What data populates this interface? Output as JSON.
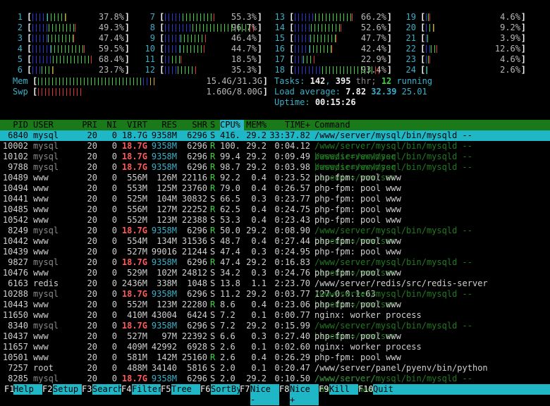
{
  "cpus": [
    {
      "id": "1",
      "pct": "37.8%",
      "low": 0.16,
      "norm": 0.2,
      "high": 0.02
    },
    {
      "id": "2",
      "pct": "49.3%",
      "low": 0.18,
      "norm": 0.28,
      "high": 0.03
    },
    {
      "id": "3",
      "pct": "47.4%",
      "low": 0.17,
      "norm": 0.28,
      "high": 0.02
    },
    {
      "id": "4",
      "pct": "59.5%",
      "low": 0.2,
      "norm": 0.36,
      "high": 0.03
    },
    {
      "id": "5",
      "pct": "68.4%",
      "low": 0.22,
      "norm": 0.42,
      "high": 0.04
    },
    {
      "id": "6",
      "pct": "23.7%",
      "low": 0.1,
      "norm": 0.12,
      "high": 0.02
    },
    {
      "id": "7",
      "pct": "55.3%",
      "low": 0.19,
      "norm": 0.34,
      "high": 0.02
    },
    {
      "id": "8",
      "pct": "96.7%",
      "low": 0.3,
      "norm": 0.62,
      "high": 0.05
    },
    {
      "id": "9",
      "pct": "46.4%",
      "low": 0.17,
      "norm": 0.27,
      "high": 0.02
    },
    {
      "id": "10",
      "pct": "44.7%",
      "low": 0.16,
      "norm": 0.26,
      "high": 0.03
    },
    {
      "id": "11",
      "pct": "18.5%",
      "low": 0.08,
      "norm": 0.09,
      "high": 0.02
    },
    {
      "id": "12",
      "pct": "35.3%",
      "low": 0.14,
      "norm": 0.19,
      "high": 0.02
    },
    {
      "id": "13",
      "pct": "66.2%",
      "low": 0.22,
      "norm": 0.4,
      "high": 0.04
    },
    {
      "id": "14",
      "pct": "52.6%",
      "low": 0.18,
      "norm": 0.32,
      "high": 0.03
    },
    {
      "id": "15",
      "pct": "47.7%",
      "low": 0.17,
      "norm": 0.28,
      "high": 0.03
    },
    {
      "id": "16",
      "pct": "42.4%",
      "low": 0.16,
      "norm": 0.24,
      "high": 0.02
    },
    {
      "id": "17",
      "pct": "22.9%",
      "low": 0.09,
      "norm": 0.12,
      "high": 0.02
    },
    {
      "id": "18",
      "pct": "93.4%",
      "low": 0.3,
      "norm": 0.58,
      "high": 0.05
    },
    {
      "id": "19",
      "pct": "4.6%",
      "low": 0.02,
      "norm": 0.02,
      "high": 0.006
    },
    {
      "id": "20",
      "pct": "9.2%",
      "low": 0.04,
      "norm": 0.04,
      "high": 0.012
    },
    {
      "id": "21",
      "pct": "3.9%",
      "low": 0.015,
      "norm": 0.02,
      "high": 0.004
    },
    {
      "id": "22",
      "pct": "12.6%",
      "low": 0.05,
      "norm": 0.06,
      "high": 0.016
    },
    {
      "id": "23",
      "pct": "4.6%",
      "low": 0.02,
      "norm": 0.02,
      "high": 0.006
    },
    {
      "id": "24",
      "pct": "2.6%",
      "low": 0.01,
      "norm": 0.012,
      "high": 0.004
    }
  ],
  "mem": {
    "label": "Mem",
    "value": "15.4G/31.3G",
    "used": 0.47,
    "buffers": 0.03,
    "cache": 0.02
  },
  "swp": {
    "label": "Swp",
    "value": "1.60G/8.00G",
    "used": 0.2
  },
  "tasks": {
    "label": "Tasks:",
    "count": "142",
    "sep1": ",",
    "thr": "395",
    "thr_label": "thr;",
    "running": "12",
    "running_label": "running"
  },
  "load": {
    "label": "Load average:",
    "l1": "7.82",
    "l5": "32.39",
    "l15": "25.01"
  },
  "uptime": {
    "label": "Uptime:",
    "value": "00:15:26"
  },
  "headers": {
    "pid": "PID",
    "user": "USER",
    "pri": "PRI",
    "ni": "NI",
    "virt": "VIRT",
    "res": "RES",
    "shr": "SHR",
    "s": "S",
    "cpu": "CPU%",
    "mem": "MEM%",
    "time": "TIME+",
    "cmd": "Command"
  },
  "processes": [
    {
      "pid": "6840",
      "user": "mysql",
      "pri": "20",
      "ni": "0",
      "virt": "18.7G",
      "res": "9358M",
      "shr": "6296",
      "s": "S",
      "cpu": "416.",
      "mem": "29.2",
      "time": "33:37.82",
      "cmd": "/www/server/mysql/bin/mysqld --basedir=/www/ser"
    },
    {
      "pid": "10002",
      "user": "mysql",
      "pri": "20",
      "ni": "0",
      "virt": "18.7G",
      "res": "9358M",
      "shr": "6296",
      "s": "R",
      "cpu": "100.",
      "mem": "29.2",
      "time": "0:04.12",
      "cmd": "/www/server/mysql/bin/mysqld --basedir=/www/ser"
    },
    {
      "pid": "10102",
      "user": "mysql",
      "pri": "20",
      "ni": "0",
      "virt": "18.7G",
      "res": "9358M",
      "shr": "6296",
      "s": "R",
      "cpu": "99.4",
      "mem": "29.2",
      "time": "0:09.49",
      "cmd": "/www/server/mysql/bin/mysqld --basedir=/www/ser"
    },
    {
      "pid": "9788",
      "user": "mysql",
      "pri": "20",
      "ni": "0",
      "virt": "18.7G",
      "res": "9358M",
      "shr": "6296",
      "s": "R",
      "cpu": "98.7",
      "mem": "29.2",
      "time": "0:03.98",
      "cmd": "/www/server/mysql/bin/mysqld --basedir=/www/ser"
    },
    {
      "pid": "10489",
      "user": "www",
      "pri": "20",
      "ni": "0",
      "virt": "556M",
      "res": "126M",
      "shr": "22116",
      "s": "R",
      "cpu": "92.2",
      "mem": "0.4",
      "time": "0:23.52",
      "cmd": "php-fpm: pool www"
    },
    {
      "pid": "10494",
      "user": "www",
      "pri": "20",
      "ni": "0",
      "virt": "553M",
      "res": "125M",
      "shr": "23760",
      "s": "R",
      "cpu": "79.0",
      "mem": "0.4",
      "time": "0:26.57",
      "cmd": "php-fpm: pool www"
    },
    {
      "pid": "10441",
      "user": "www",
      "pri": "20",
      "ni": "0",
      "virt": "525M",
      "res": "104M",
      "shr": "30832",
      "s": "S",
      "cpu": "66.5",
      "mem": "0.3",
      "time": "0:23.77",
      "cmd": "php-fpm: pool www"
    },
    {
      "pid": "10485",
      "user": "www",
      "pri": "20",
      "ni": "0",
      "virt": "556M",
      "res": "127M",
      "shr": "22252",
      "s": "R",
      "cpu": "62.5",
      "mem": "0.4",
      "time": "0:24.75",
      "cmd": "php-fpm: pool www"
    },
    {
      "pid": "10542",
      "user": "www",
      "pri": "20",
      "ni": "0",
      "virt": "552M",
      "res": "123M",
      "shr": "22388",
      "s": "S",
      "cpu": "53.3",
      "mem": "0.4",
      "time": "0:23.43",
      "cmd": "php-fpm: pool www"
    },
    {
      "pid": "8249",
      "user": "mysql",
      "pri": "20",
      "ni": "0",
      "virt": "18.7G",
      "res": "9358M",
      "shr": "6296",
      "s": "R",
      "cpu": "50.0",
      "mem": "29.2",
      "time": "0:08.90",
      "cmd": "/www/server/mysql/bin/mysqld --basedir=/www/ser"
    },
    {
      "pid": "10442",
      "user": "www",
      "pri": "20",
      "ni": "0",
      "virt": "554M",
      "res": "134M",
      "shr": "31536",
      "s": "S",
      "cpu": "48.7",
      "mem": "0.4",
      "time": "0:27.44",
      "cmd": "php-fpm: pool www"
    },
    {
      "pid": "10439",
      "user": "www",
      "pri": "20",
      "ni": "0",
      "virt": "527M",
      "res": "99016",
      "shr": "21244",
      "s": "S",
      "cpu": "47.4",
      "mem": "0.3",
      "time": "0:24.95",
      "cmd": "php-fpm: pool www"
    },
    {
      "pid": "9827",
      "user": "mysql",
      "pri": "20",
      "ni": "0",
      "virt": "18.7G",
      "res": "9358M",
      "shr": "6296",
      "s": "R",
      "cpu": "47.4",
      "mem": "29.2",
      "time": "0:16.83",
      "cmd": "/www/server/mysql/bin/mysqld --basedir=/www/ser"
    },
    {
      "pid": "10476",
      "user": "www",
      "pri": "20",
      "ni": "0",
      "virt": "529M",
      "res": "102M",
      "shr": "24812",
      "s": "S",
      "cpu": "34.2",
      "mem": "0.3",
      "time": "0:24.76",
      "cmd": "php-fpm: pool www"
    },
    {
      "pid": "6163",
      "user": "redis",
      "pri": "20",
      "ni": "0",
      "virt": "2436M",
      "res": "338M",
      "shr": "1048",
      "s": "S",
      "cpu": "13.8",
      "mem": "1.1",
      "time": "2:23.70",
      "cmd": "/www/server/redis/src/redis-server 127.0.0.1:63"
    },
    {
      "pid": "10288",
      "user": "mysql",
      "pri": "20",
      "ni": "0",
      "virt": "18.7G",
      "res": "9358M",
      "shr": "6296",
      "s": "S",
      "cpu": "11.2",
      "mem": "29.2",
      "time": "0:03.77",
      "cmd": "/www/server/mysql/bin/mysqld --basedir=/www/ser"
    },
    {
      "pid": "10443",
      "user": "www",
      "pri": "20",
      "ni": "0",
      "virt": "552M",
      "res": "123M",
      "shr": "22280",
      "s": "R",
      "cpu": "8.6",
      "mem": "0.4",
      "time": "0:23.06",
      "cmd": "php-fpm: pool www"
    },
    {
      "pid": "11650",
      "user": "www",
      "pri": "20",
      "ni": "0",
      "virt": "410M",
      "res": "43004",
      "shr": "6424",
      "s": "S",
      "cpu": "7.2",
      "mem": "0.1",
      "time": "0:00.77",
      "cmd": "nginx: worker process"
    },
    {
      "pid": "8340",
      "user": "mysql",
      "pri": "20",
      "ni": "0",
      "virt": "18.7G",
      "res": "9358M",
      "shr": "6296",
      "s": "S",
      "cpu": "7.2",
      "mem": "29.2",
      "time": "0:15.99",
      "cmd": "/www/server/mysql/bin/mysqld --basedir=/www/ser"
    },
    {
      "pid": "10437",
      "user": "www",
      "pri": "20",
      "ni": "0",
      "virt": "527M",
      "res": "97M",
      "shr": "22392",
      "s": "S",
      "cpu": "6.6",
      "mem": "0.3",
      "time": "0:27.40",
      "cmd": "php-fpm: pool www"
    },
    {
      "pid": "11657",
      "user": "www",
      "pri": "20",
      "ni": "0",
      "virt": "409M",
      "res": "42992",
      "shr": "6928",
      "s": "S",
      "cpu": "2.6",
      "mem": "0.1",
      "time": "0:02.60",
      "cmd": "nginx: worker process"
    },
    {
      "pid": "10501",
      "user": "www",
      "pri": "20",
      "ni": "0",
      "virt": "581M",
      "res": "142M",
      "shr": "25160",
      "s": "R",
      "cpu": "2.6",
      "mem": "0.4",
      "time": "0:26.29",
      "cmd": "php-fpm: pool www"
    },
    {
      "pid": "7257",
      "user": "root",
      "pri": "20",
      "ni": "0",
      "virt": "488M",
      "res": "34140",
      "shr": "5816",
      "s": "S",
      "cpu": "2.0",
      "mem": "0.1",
      "time": "0:20.47",
      "cmd": "/www/server/panel/pyenv/bin/python /www/server/"
    },
    {
      "pid": "8285",
      "user": "mysql",
      "pri": "20",
      "ni": "0",
      "virt": "18.7G",
      "res": "9358M",
      "shr": "6296",
      "s": "S",
      "cpu": "2.0",
      "mem": "29.2",
      "time": "0:10.50",
      "cmd": "/www/server/mysql/bin/mysqld --basedir=/www/ser"
    }
  ],
  "footer": [
    {
      "key": "F1",
      "label": "Help  "
    },
    {
      "key": "F2",
      "label": "Setup "
    },
    {
      "key": "F3",
      "label": "Search"
    },
    {
      "key": "F4",
      "label": "Filter"
    },
    {
      "key": "F5",
      "label": "Tree  "
    },
    {
      "key": "F6",
      "label": "SortBy"
    },
    {
      "key": "F7",
      "label": "Nice -"
    },
    {
      "key": "F8",
      "label": "Nice +"
    },
    {
      "key": "F9",
      "label": "Kill  "
    },
    {
      "key": "F10",
      "label": "Quit"
    }
  ],
  "colors": {
    "bar_low": "#2d3ad0",
    "bar_norm": "#3cd53c",
    "bar_high": "#e03030",
    "mem_buf": "#2d3ad0",
    "mem_cache": "#d4b020",
    "swp": "#e03030",
    "header_bg": "#1a7a1a",
    "selected_bg": "#1fb6c6"
  }
}
